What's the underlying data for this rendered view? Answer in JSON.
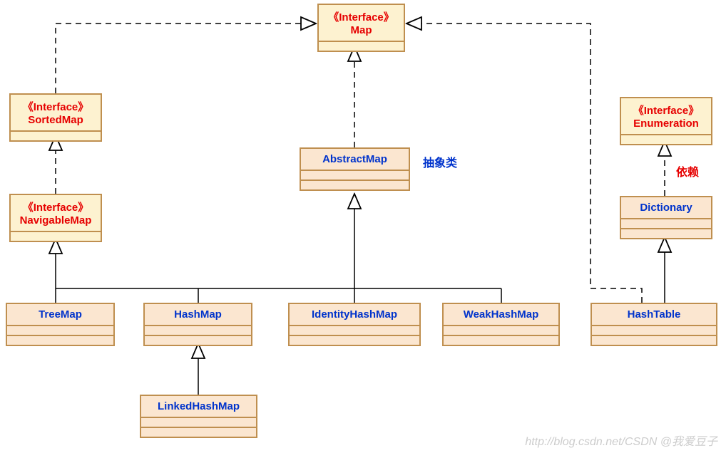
{
  "interfaces": {
    "map": {
      "stereotype": "《Interface》",
      "name": "Map"
    },
    "sortedMap": {
      "stereotype": "《Interface》",
      "name": "SortedMap"
    },
    "navigableMap": {
      "stereotype": "《Interface》",
      "name": "NavigableMap"
    },
    "enumeration": {
      "stereotype": "《Interface》",
      "name": "Enumeration"
    }
  },
  "classes": {
    "abstractMap": "AbstractMap",
    "dictionary": "Dictionary",
    "treeMap": "TreeMap",
    "hashMap": "HashMap",
    "identityHashMap": "IdentityHashMap",
    "weakHashMap": "WeakHashMap",
    "hashTable": "HashTable",
    "linkedHashMap": "LinkedHashMap"
  },
  "annotations": {
    "abstractClass": "抽象类",
    "dependency": "依赖"
  },
  "watermark": "http://blog.csdn.net/CSDN @我爱豆子"
}
